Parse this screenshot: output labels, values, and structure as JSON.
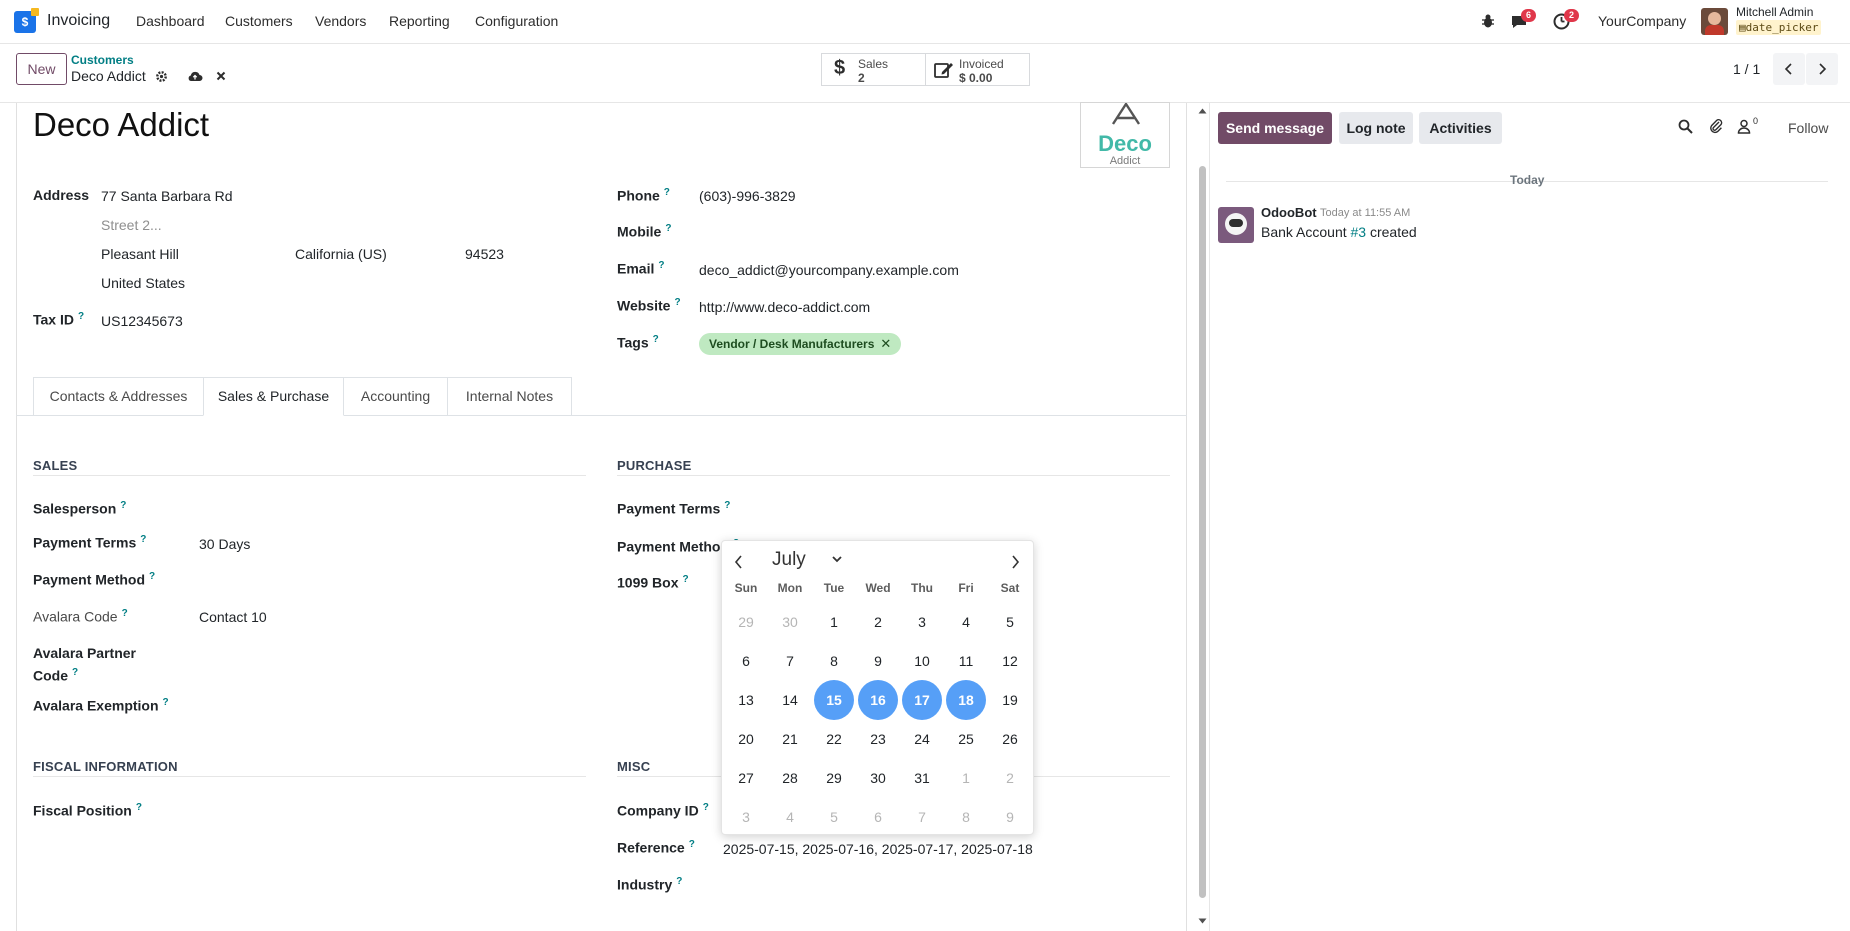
{
  "navbar": {
    "app_name": "Invoicing",
    "menu": [
      "Dashboard",
      "Customers",
      "Vendors",
      "Reporting",
      "Configuration"
    ],
    "messages_count": "6",
    "activities_count": "2",
    "company": "YourCompany",
    "user_name": "Mitchell Admin",
    "db_name": "date_picker"
  },
  "control": {
    "new_label": "New",
    "breadcrumb_parent": "Customers",
    "breadcrumb_current": "Deco Addict",
    "sales_label": "Sales",
    "sales_value": "2",
    "invoiced_label": "Invoiced",
    "invoiced_value": "$ 0.00",
    "pager": "1 / 1"
  },
  "partner": {
    "name": "Deco Addict",
    "logo_text": "Deco",
    "logo_sub": "Addict",
    "address_label": "Address",
    "street": "77 Santa Barbara Rd",
    "street2_placeholder": "Street 2...",
    "city": "Pleasant Hill",
    "state": "California (US)",
    "zip": "94523",
    "country": "United States",
    "tax_id_label": "Tax ID",
    "tax_id": "US12345673",
    "phone_label": "Phone",
    "phone": "(603)-996-3829",
    "mobile_label": "Mobile",
    "email_label": "Email",
    "email": "deco_addict@yourcompany.example.com",
    "website_label": "Website",
    "website": "http://www.deco-addict.com",
    "tags_label": "Tags",
    "tag": "Vendor / Desk Manufacturers"
  },
  "tabs": [
    "Contacts & Addresses",
    "Sales & Purchase",
    "Accounting",
    "Internal Notes"
  ],
  "sales": {
    "title": "SALES",
    "salesperson_label": "Salesperson",
    "payment_terms_label": "Payment Terms",
    "payment_terms": "30 Days",
    "payment_method_label": "Payment Method",
    "avalara_code_label": "Avalara Code",
    "avalara_code": "Contact 10",
    "avalara_partner_label_1": "Avalara Partner",
    "avalara_partner_label_2": "Code",
    "avalara_exemption_label": "Avalara Exemption"
  },
  "purchase": {
    "title": "PURCHASE",
    "payment_terms_label": "Payment Terms",
    "payment_method_label": "Payment Method",
    "box_1099_label": "1099 Box"
  },
  "fiscal": {
    "title": "FISCAL INFORMATION",
    "fiscal_position_label": "Fiscal Position"
  },
  "misc": {
    "title": "MISC",
    "company_id_label": "Company ID",
    "reference_label": "Reference",
    "reference": "2025-07-15, 2025-07-16, 2025-07-17, 2025-07-18",
    "industry_label": "Industry"
  },
  "datepicker": {
    "month": "July",
    "weekdays": [
      "Sun",
      "Mon",
      "Tue",
      "Wed",
      "Thu",
      "Fri",
      "Sat"
    ],
    "weeks": [
      [
        {
          "d": "29",
          "o": true
        },
        {
          "d": "30",
          "o": true
        },
        {
          "d": "1"
        },
        {
          "d": "2"
        },
        {
          "d": "3"
        },
        {
          "d": "4"
        },
        {
          "d": "5"
        }
      ],
      [
        {
          "d": "6"
        },
        {
          "d": "7"
        },
        {
          "d": "8"
        },
        {
          "d": "9"
        },
        {
          "d": "10"
        },
        {
          "d": "11"
        },
        {
          "d": "12"
        }
      ],
      [
        {
          "d": "13"
        },
        {
          "d": "14"
        },
        {
          "d": "15",
          "s": true
        },
        {
          "d": "16",
          "s": true
        },
        {
          "d": "17",
          "s": true
        },
        {
          "d": "18",
          "s": true
        },
        {
          "d": "19"
        }
      ],
      [
        {
          "d": "20"
        },
        {
          "d": "21"
        },
        {
          "d": "22"
        },
        {
          "d": "23"
        },
        {
          "d": "24"
        },
        {
          "d": "25"
        },
        {
          "d": "26"
        }
      ],
      [
        {
          "d": "27"
        },
        {
          "d": "28"
        },
        {
          "d": "29"
        },
        {
          "d": "30"
        },
        {
          "d": "31"
        },
        {
          "d": "1",
          "o": true
        },
        {
          "d": "2",
          "o": true
        }
      ],
      [
        {
          "d": "3",
          "o": true
        },
        {
          "d": "4",
          "o": true
        },
        {
          "d": "5",
          "o": true
        },
        {
          "d": "6",
          "o": true
        },
        {
          "d": "7",
          "o": true
        },
        {
          "d": "8",
          "o": true
        },
        {
          "d": "9",
          "o": true
        }
      ]
    ],
    "selected_color": "#569ff7"
  },
  "chatter": {
    "send_message": "Send message",
    "log_note": "Log note",
    "activities": "Activities",
    "followers_count": "0",
    "follow": "Follow",
    "date_separator": "Today",
    "author": "OdooBot",
    "time": "Today at 11:55 AM",
    "body_prefix": "Bank Account",
    "body_link": "#3",
    "body_suffix": "created"
  },
  "colors": {
    "brand": "#714b67",
    "link": "#017e84",
    "badge": "#e0374a"
  }
}
